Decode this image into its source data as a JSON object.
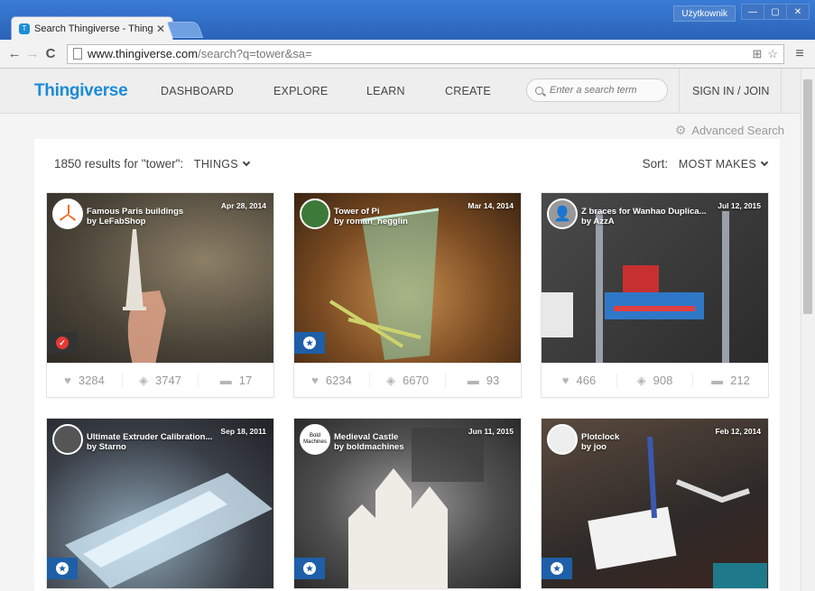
{
  "browser": {
    "tab_title": "Search Thingiverse - Thingiv",
    "url_host": "www.thingiverse.com",
    "url_path": "/search?q=tower&sa=",
    "user_label": "Użytkownik"
  },
  "site": {
    "logo": "Thingiverse",
    "nav": [
      "DASHBOARD",
      "EXPLORE",
      "LEARN",
      "CREATE"
    ],
    "search_placeholder": "Enter a search term",
    "signin": "SIGN IN / JOIN",
    "advanced_search": "Advanced Search"
  },
  "results": {
    "summary": "1850 results for \"tower\":",
    "filter": "THINGS",
    "sort_label": "Sort:",
    "sort_value": "MOST MAKES"
  },
  "cards": [
    {
      "title": "Famous Paris buildings",
      "by": "by LeFabShop",
      "date": "Apr 28, 2014",
      "likes": "3284",
      "collects": "3747",
      "comments": "17",
      "badge": "made"
    },
    {
      "title": "Tower of Pi",
      "by": "by roman_hegglin",
      "date": "Mar 14, 2014",
      "likes": "6234",
      "collects": "6670",
      "comments": "93",
      "badge": "featured"
    },
    {
      "title": "Z braces for Wanhao Duplica...",
      "by": "by AzzA",
      "date": "Jul 12, 2015",
      "likes": "466",
      "collects": "908",
      "comments": "212",
      "badge": "none"
    },
    {
      "title": "Ultimate Extruder Calibration...",
      "by": "by Starno",
      "date": "Sep 18, 2011",
      "badge": "featured"
    },
    {
      "title": "Medieval Castle",
      "by": "by boldmachines",
      "date": "Jun 11, 2015",
      "avatar_text": "Bold Machines",
      "badge": "featured"
    },
    {
      "title": "Plotclock",
      "by": "by joo",
      "date": "Feb 12, 2014",
      "badge": "featured"
    }
  ]
}
